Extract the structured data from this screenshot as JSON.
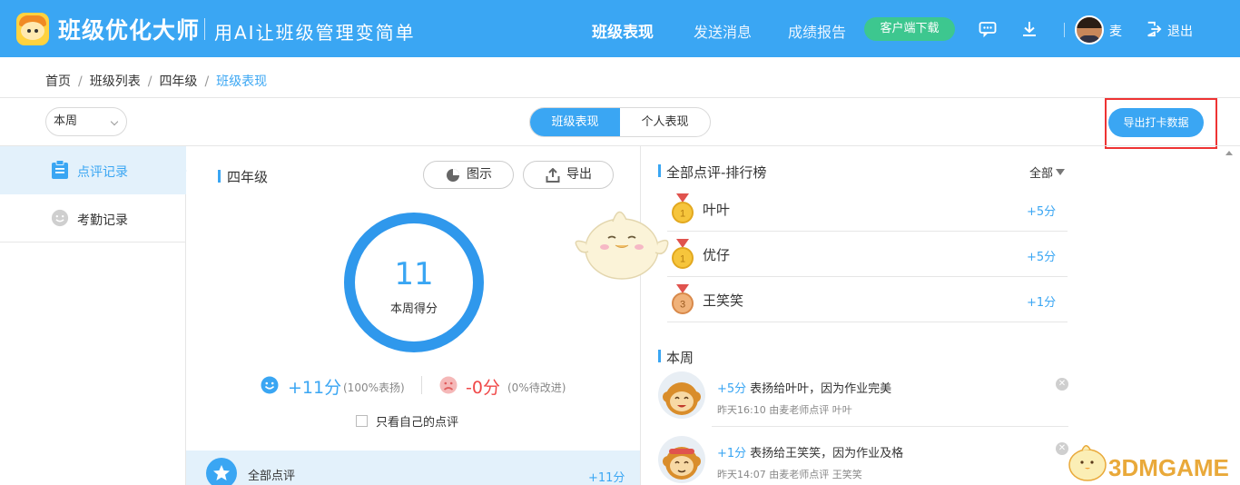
{
  "header": {
    "brand": "班级优化大师",
    "slogan": "用AI让班级管理变简单",
    "nav": [
      "班级表现",
      "发送消息",
      "成绩报告"
    ],
    "download_label": "客户端下载",
    "user_name": "麦",
    "logout_label": "退出",
    "icons": [
      "message-icon",
      "download-icon",
      "logout-icon"
    ]
  },
  "breadcrumb": [
    "首页",
    "班级列表",
    "四年级",
    "班级表现"
  ],
  "toolbar": {
    "period_selected": "本周",
    "view_tabs": [
      "班级表现",
      "个人表现"
    ],
    "export_label": "导出打卡数据"
  },
  "sidebar": {
    "items": [
      {
        "label": "点评记录",
        "icon": "clipboard-icon"
      },
      {
        "label": "考勤记录",
        "icon": "smiley-icon"
      }
    ]
  },
  "summary": {
    "class_name": "四年级",
    "legend_label": "图示",
    "export_label": "导出",
    "score": "11",
    "score_label": "本周得分",
    "positive_points": "+11分",
    "positive_note": "(100%表扬)",
    "negative_points": "-0分",
    "negative_note": "(0%待改进)",
    "own_only_label": "只看自己的点评",
    "all_label": "全部点评",
    "all_points": "+11分"
  },
  "ranking": {
    "title": "全部点评-排行榜",
    "filter": "全部",
    "rows": [
      {
        "rank": "1",
        "name": "叶叶",
        "points": "+5分"
      },
      {
        "rank": "1",
        "name": "优仔",
        "points": "+5分"
      },
      {
        "rank": "3",
        "name": "王笑笑",
        "points": "+1分"
      }
    ]
  },
  "week": {
    "title": "本周",
    "feed": [
      {
        "points": "+5分",
        "text": "表扬给叶叶，因为作业完美",
        "meta": "昨天16:10 由麦老师点评 叶叶"
      },
      {
        "points": "+1分",
        "text": "表扬给王笑笑，因为作业及格",
        "meta": "昨天14:07 由麦老师点评 王笑笑"
      }
    ]
  },
  "watermark": "3DMGAME",
  "colors": {
    "accent": "#3aa6f3",
    "download_green": "#3dc78f",
    "negative": "#f04848",
    "highlight_box": "#e33333"
  }
}
